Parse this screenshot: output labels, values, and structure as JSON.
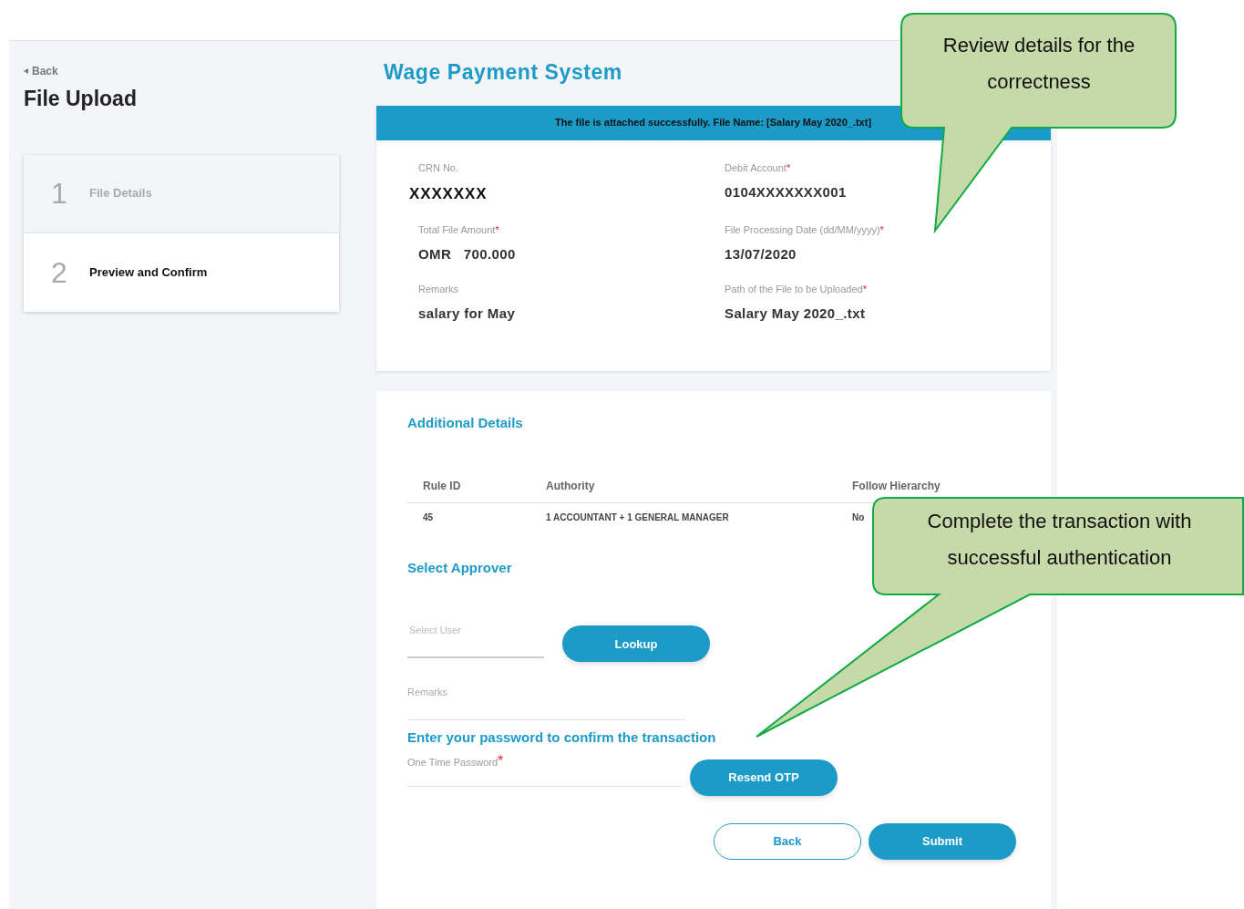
{
  "back_link": "Back",
  "page_title": "File Upload",
  "steps": [
    {
      "number": "1",
      "label": "File Details",
      "selected": false
    },
    {
      "number": "2",
      "label": "Preview and Confirm",
      "selected": true
    }
  ],
  "app_title": "Wage Payment System",
  "banner": "The file is attached successfully. File Name: [Salary May 2020_.txt]",
  "fields": [
    {
      "label": "CRN No.",
      "value": "XXXXXXX",
      "kind": "large"
    },
    {
      "label": "Debit Account",
      "required_mark": "*",
      "value": "0104XXXXXXX001",
      "kind": "normal"
    },
    {
      "label": "Total File Amount",
      "required_mark": "*",
      "value": "OMR   700.000",
      "kind": "normal"
    },
    {
      "label": "File Processing Date (dd/MM/yyyy)",
      "required_mark": "*",
      "value": "13/07/2020",
      "kind": "normal"
    },
    {
      "label": "Remarks",
      "value": "salary for May",
      "kind": "normal"
    },
    {
      "label": "Path of the File to be Uploaded",
      "required_mark": "*",
      "value": "Salary May 2020_.txt",
      "kind": "normal"
    }
  ],
  "additional_details": {
    "title": "Additional Details",
    "table": {
      "columns": [
        "Rule ID",
        "Authority",
        "Follow Hierarchy"
      ],
      "rows": [
        [
          "45",
          "1 ACCOUNTANT + 1 GENERAL MANAGER",
          "No"
        ]
      ]
    }
  },
  "select_approver": {
    "title": "Select Approver",
    "select_user_label": "Select User",
    "lookup_button": "Lookup",
    "remarks_label": "Remarks"
  },
  "confirm": {
    "title": "Enter your password to confirm the transaction",
    "otp_label": "One Time Password",
    "otp_required_mark": "*",
    "resend_button": "Resend OTP"
  },
  "buttons": [
    {
      "label": "Back",
      "kind": "outline"
    },
    {
      "label": "Submit",
      "kind": "primary"
    }
  ],
  "callouts": [
    {
      "text": "Review details for the correctness"
    },
    {
      "text": "Complete the transaction with successful authentication"
    }
  ]
}
